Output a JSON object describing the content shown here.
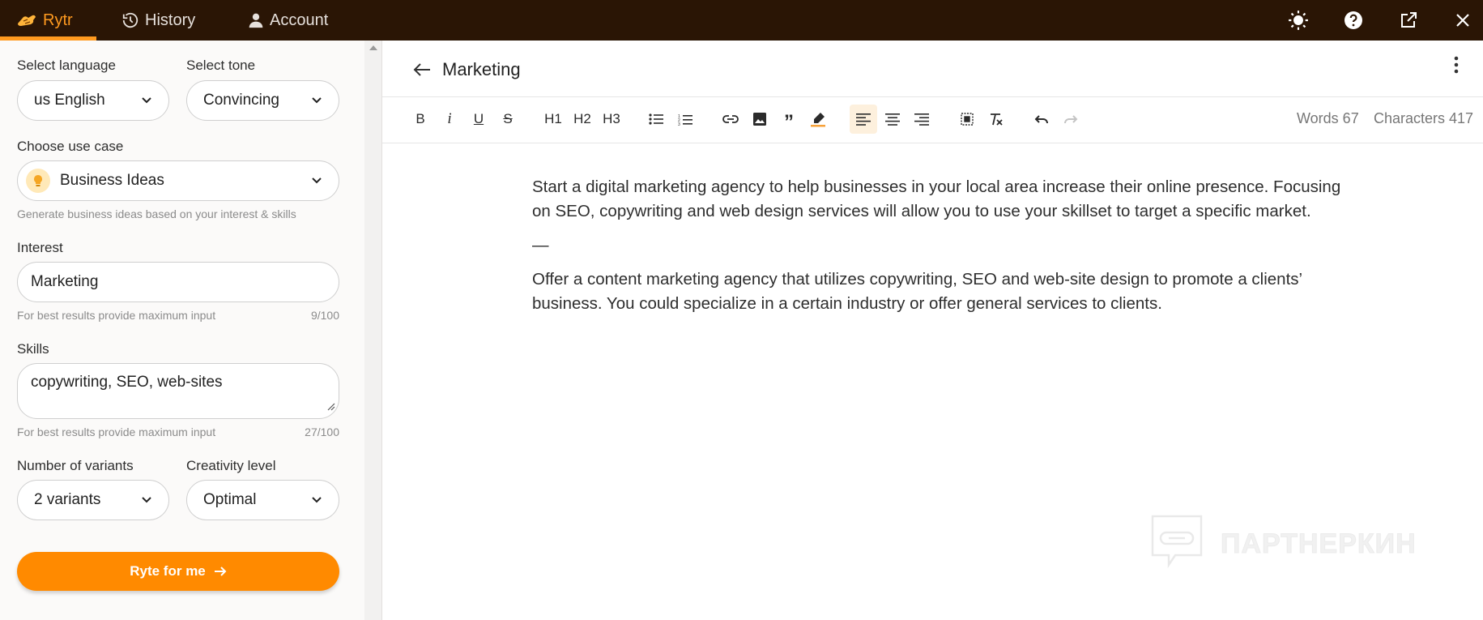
{
  "nav": {
    "tabs": [
      {
        "label": "Rytr",
        "icon": "rytr-logo-icon"
      },
      {
        "label": "History",
        "icon": "history-icon"
      },
      {
        "label": "Account",
        "icon": "person-icon"
      }
    ],
    "right_icons": [
      "theme-sun-icon",
      "help-icon",
      "open-external-icon",
      "close-icon"
    ]
  },
  "settings": {
    "language": {
      "label": "Select language",
      "value": "us English"
    },
    "tone": {
      "label": "Select tone",
      "value": "Convincing"
    },
    "use_case": {
      "label": "Choose use case",
      "value": "Business Ideas",
      "hint": "Generate business ideas based on your interest & skills"
    },
    "interest": {
      "label": "Interest",
      "value": "Marketing",
      "hint": "For best results provide maximum input",
      "count": "9/100"
    },
    "skills": {
      "label": "Skills",
      "value": "copywriting, SEO, web-sites",
      "hint": "For best results provide maximum input",
      "count": "27/100"
    },
    "variants": {
      "label": "Number of variants",
      "value": "2 variants"
    },
    "creativity": {
      "label": "Creativity level",
      "value": "Optimal"
    },
    "submit_label": "Ryte for me"
  },
  "editor": {
    "title": "Marketing",
    "toolbar": {
      "heading1": "H1",
      "heading2": "H2",
      "heading3": "H3"
    },
    "stats": {
      "words": "Words 67",
      "characters": "Characters 417"
    },
    "paragraphs": [
      "Start a digital marketing agency to help businesses in your local area increase their online presence. Focusing on SEO, copywriting and web design services will allow you to use your skillset to target a specific market.",
      "—",
      "Offer a content marketing agency that utilizes copywriting, SEO and web-site design to promote a clients’ business. You could specialize in a certain industry or offer general services to clients."
    ]
  },
  "watermark": {
    "text": "ПАРТНЕРКИН"
  },
  "colors": {
    "nav_bg": "#2a1505",
    "accent": "#ff8a00",
    "active_tab": "#ff9a1f"
  }
}
